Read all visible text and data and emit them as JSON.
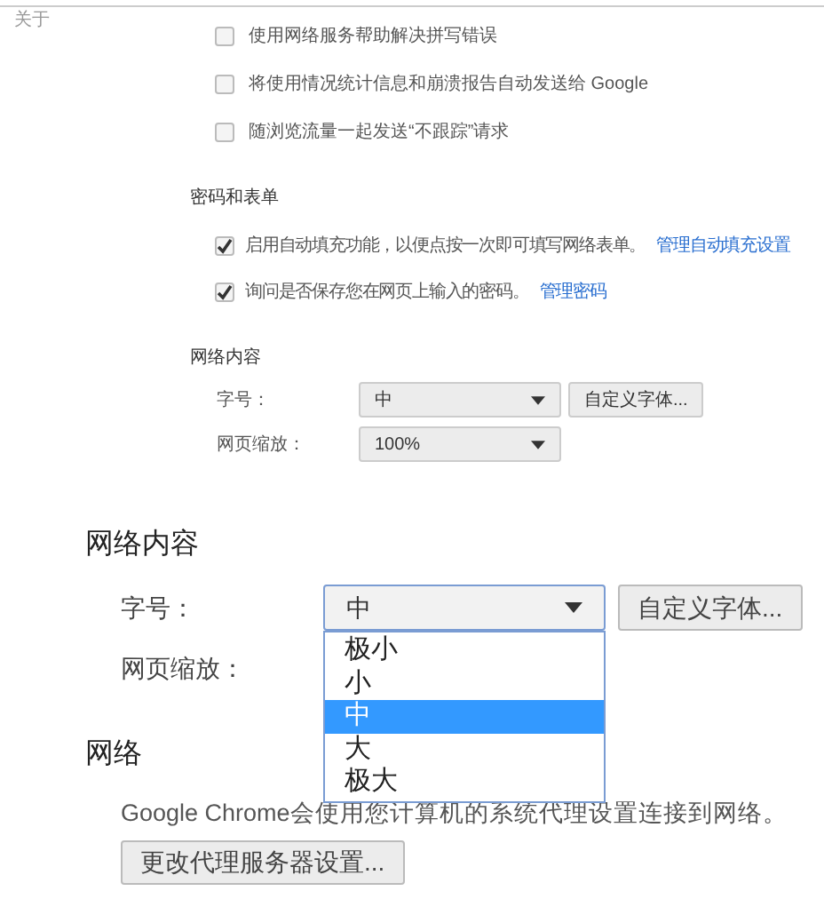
{
  "top_panel": {
    "about_label": "关于",
    "privacy_options": [
      {
        "label": "使用网络服务帮助解决拼写错误",
        "checked": false
      },
      {
        "label": "将使用情况统计信息和崩溃报告自动发送给 Google",
        "checked": false
      },
      {
        "label": "随浏览流量一起发送“不跟踪”请求",
        "checked": false
      }
    ],
    "passwords": {
      "heading": "密码和表单",
      "options": [
        {
          "label": "启用自动填充功能，以便点按一次即可填写网络表单。",
          "checked": true,
          "link": "管理自动填充设置"
        },
        {
          "label": "询问是否保存您在网页上输入的密码。",
          "checked": true,
          "link": "管理密码"
        }
      ]
    },
    "web_content": {
      "heading": "网络内容",
      "font_size": {
        "label": "字号：",
        "value": "中"
      },
      "custom_font_button": "自定义字体...",
      "zoom": {
        "label": "网页缩放：",
        "value": "100%"
      }
    }
  },
  "bottom_panel": {
    "web_content": {
      "heading": "网络内容",
      "font_size": {
        "label": "字号：",
        "value": "中",
        "expanded": true,
        "options": [
          {
            "label": "极小",
            "selected": false
          },
          {
            "label": "小",
            "selected": false
          },
          {
            "label": "中",
            "selected": true
          },
          {
            "label": "大",
            "selected": false
          },
          {
            "label": "极大",
            "selected": false
          }
        ]
      },
      "custom_font_button": "自定义字体...",
      "zoom_label": "网页缩放："
    },
    "network": {
      "heading": "网络",
      "description": "Google Chrome会使用您计算机的系统代理设置连接到网络。",
      "proxy_button": "更改代理服务器设置..."
    }
  }
}
